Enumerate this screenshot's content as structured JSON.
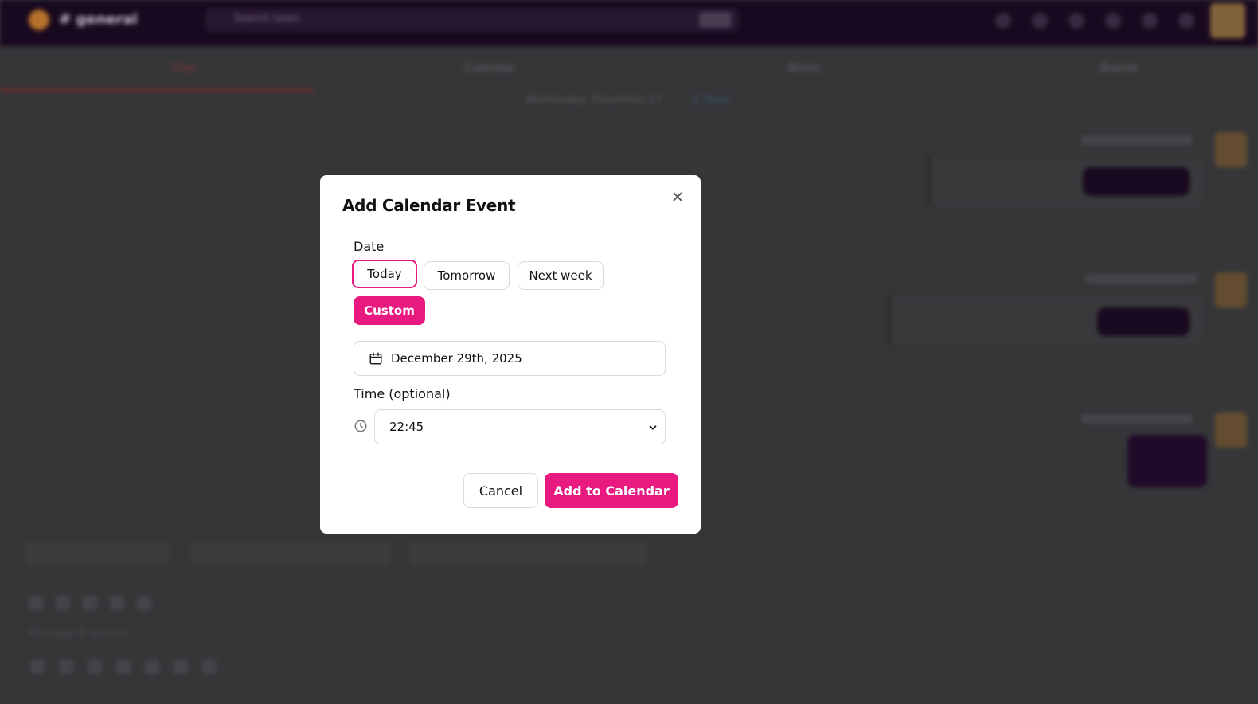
{
  "background": {
    "channel": "# general",
    "search_placeholder": "Search tasks",
    "tabs": [
      "Chat",
      "Calendar",
      "Notes",
      "Boards"
    ],
    "date_header": "Wednesday, December 17",
    "date_link": "2 Tasks",
    "compose_placeholder": "Message # general"
  },
  "modal": {
    "title": "Add Calendar Event",
    "date_label": "Date",
    "chips": {
      "today": "Today",
      "tomorrow": "Tomorrow",
      "next_week": "Next week",
      "custom": "Custom"
    },
    "date_value": "December 29th, 2025",
    "time_label": "Time (optional)",
    "time_value": "22:45",
    "cancel_label": "Cancel",
    "submit_label": "Add to Calendar"
  },
  "colors": {
    "accent": "#e8197f",
    "topbar": "#1b0a22"
  },
  "icons": {
    "close": "close-icon",
    "calendar": "calendar-icon",
    "clock": "clock-icon",
    "chevron": "chevron-down-icon"
  }
}
